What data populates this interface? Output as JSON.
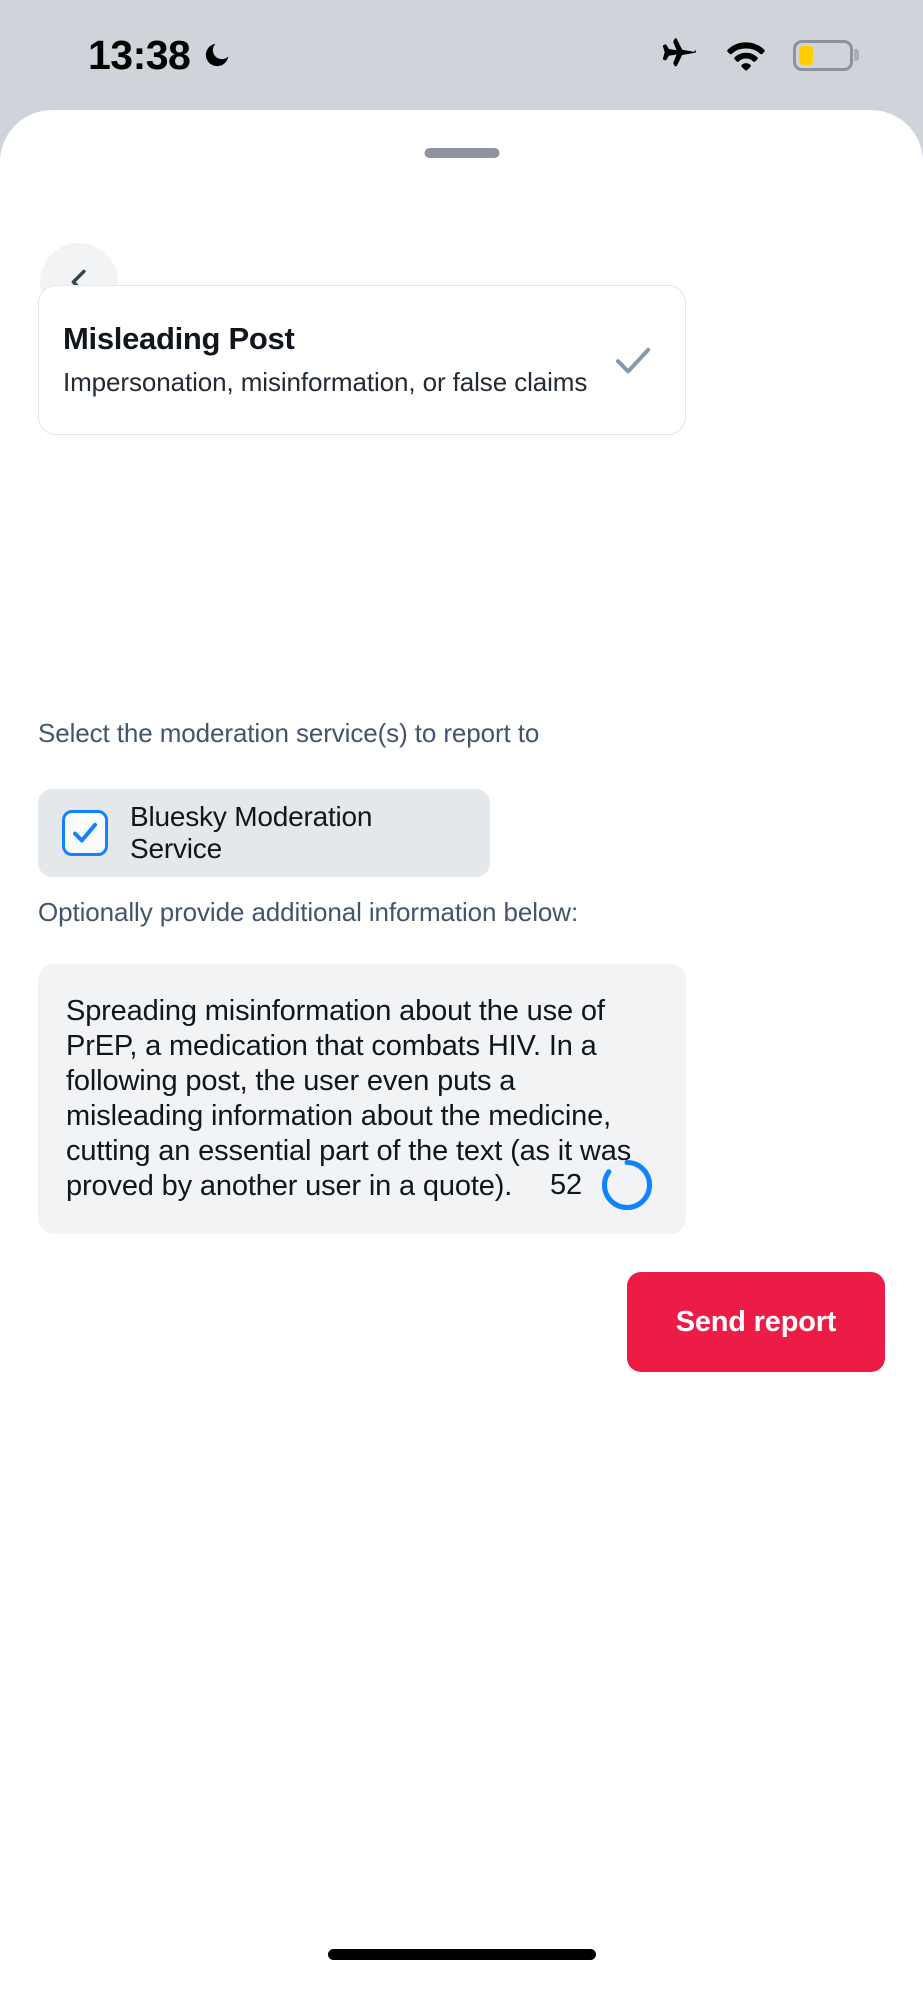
{
  "status_bar": {
    "time": "13:38",
    "icons": {
      "do_not_disturb": "moon-icon",
      "airplane_mode": "airplane-icon",
      "wifi": "wifi-icon",
      "battery": "battery-icon"
    },
    "battery_level_percent": 30,
    "battery_color": "#ffcc00"
  },
  "sheet": {
    "grabber": "drag-handle",
    "back_button": {
      "icon": "chevron-left-icon",
      "label": ""
    }
  },
  "reason_card": {
    "title": "Misleading Post",
    "description": "Impersonation, misinformation, or false claims",
    "selected": true,
    "selected_icon": "checkmark-icon",
    "checkmark_color": "#8899ad"
  },
  "services": {
    "label": "Select the moderation service(s) to report to",
    "options": [
      {
        "name": "Bluesky Moderation Service",
        "checked": true,
        "checkbox_icon": "checkbox-checked-icon"
      }
    ]
  },
  "details": {
    "label": "Optionally provide additional information below:",
    "value": "Spreading misinformation about the use of PrEP, a medication that combats HIV. In a following post, the user even puts a misleading information about the medicine, cutting an essential part of the text (as it was proved by another user in a quote).",
    "placeholder": "Optionally provide additional information below:",
    "char_counter": "52",
    "counter_ring_icon": "progress-ring-icon",
    "counter_ring_color": "#1083fe"
  },
  "actions": {
    "send_report_label": "Send report",
    "send_report_color": "#ec1c47"
  },
  "theme": {
    "accent_blue": "#1083fe",
    "danger_red": "#ec1c47",
    "sheet_background": "#ffffff",
    "page_background": "#ced4da",
    "muted_text": "#44556b"
  }
}
